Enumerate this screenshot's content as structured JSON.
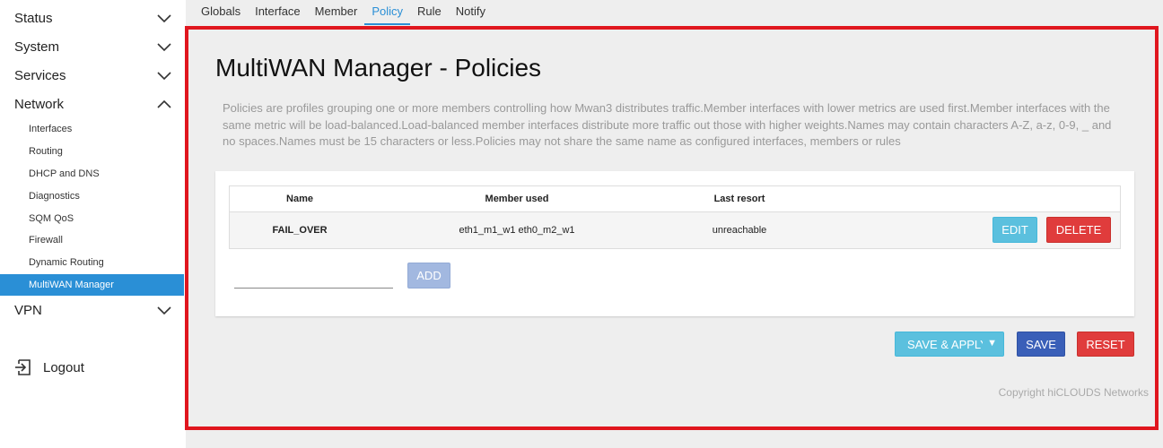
{
  "sidebar": {
    "sections": [
      {
        "label": "Status",
        "expanded": false
      },
      {
        "label": "System",
        "expanded": false
      },
      {
        "label": "Services",
        "expanded": false
      },
      {
        "label": "Network",
        "expanded": true
      },
      {
        "label": "VPN",
        "expanded": false
      }
    ],
    "network_items": [
      "Interfaces",
      "Routing",
      "DHCP and DNS",
      "Diagnostics",
      "SQM QoS",
      "Firewall",
      "Dynamic Routing",
      "MultiWAN Manager"
    ],
    "active_item": "MultiWAN Manager",
    "logout_label": "Logout"
  },
  "tabs": [
    {
      "label": "Globals",
      "active": false
    },
    {
      "label": "Interface",
      "active": false
    },
    {
      "label": "Member",
      "active": false
    },
    {
      "label": "Policy",
      "active": true
    },
    {
      "label": "Rule",
      "active": false
    },
    {
      "label": "Notify",
      "active": false
    }
  ],
  "main": {
    "title": "MultiWAN Manager - Policies",
    "description": "Policies are profiles grouping one or more members controlling how Mwan3 distributes traffic.Member interfaces with lower metrics are used first.Member interfaces with the same metric will be load-balanced.Load-balanced member interfaces distribute more traffic out those with higher weights.Names may contain characters A-Z, a-z, 0-9, _ and no spaces.Names must be 15 characters or less.Policies may not share the same name as configured interfaces, members or rules",
    "table": {
      "headers": {
        "name": "Name",
        "member": "Member used",
        "resort": "Last resort"
      },
      "rows": [
        {
          "name": "FAIL_OVER",
          "member": "eth1_m1_w1 eth0_m2_w1",
          "resort": "unreachable",
          "edit_label": "EDIT",
          "delete_label": "DELETE"
        }
      ]
    },
    "add": {
      "input_value": "",
      "placeholder": "",
      "button_label": "ADD"
    },
    "actions": {
      "save_apply_label": "SAVE & APPLY",
      "save_label": "SAVE",
      "reset_label": "RESET"
    },
    "copyright": "Copyright hiCLOUDS Networks"
  },
  "colors": {
    "accent": "#2a8fd6",
    "highlight_frame": "#e0161e",
    "danger": "#e03c3c",
    "info": "#5bc0de",
    "primary": "#3a5fb8"
  }
}
